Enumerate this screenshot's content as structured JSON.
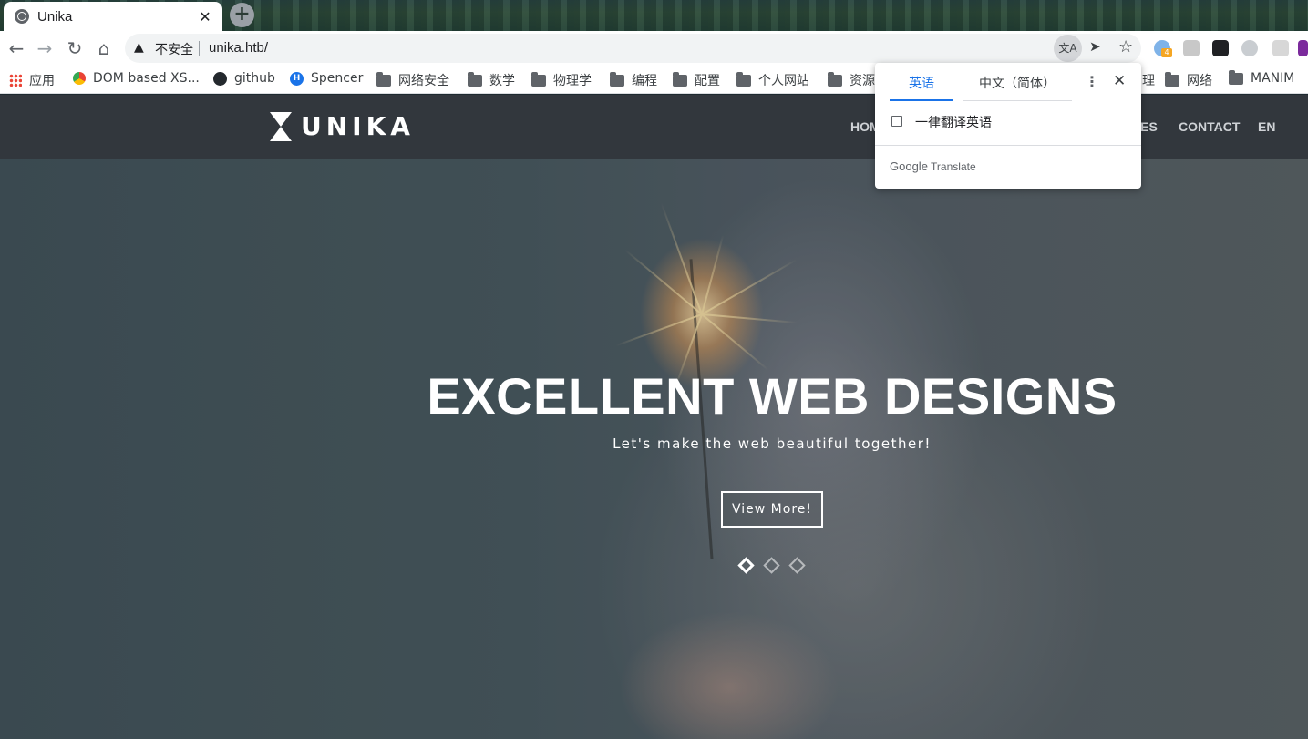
{
  "browser": {
    "tab": {
      "title": "Unika",
      "close": "✕"
    },
    "new_tab": "+",
    "omnibox": {
      "security_label": "不安全",
      "url": "unika.htb/"
    },
    "extensions": {
      "badge_count": "4"
    }
  },
  "bookmarks": [
    {
      "label": "应用",
      "icon": "apps-icon"
    },
    {
      "label": "DOM based XS...",
      "icon": "site-icon"
    },
    {
      "label": "github",
      "icon": "github-icon"
    },
    {
      "label": "Spencer",
      "icon": "hexo-icon"
    },
    {
      "label": "网络安全",
      "icon": "folder-icon"
    },
    {
      "label": "数学",
      "icon": "folder-icon"
    },
    {
      "label": "物理学",
      "icon": "folder-icon"
    },
    {
      "label": "编程",
      "icon": "folder-icon"
    },
    {
      "label": "配置",
      "icon": "folder-icon"
    },
    {
      "label": "个人网站",
      "icon": "folder-icon"
    },
    {
      "label": "资源",
      "icon": "folder-icon"
    },
    {
      "label": "理",
      "icon": "folder-icon"
    },
    {
      "label": "网络",
      "icon": "folder-icon"
    },
    {
      "label": "MANIM",
      "icon": "folder-icon"
    }
  ],
  "site": {
    "logo_text": "UNIKA",
    "menu": [
      "HOM",
      "CES",
      "CONTACT",
      "EN"
    ],
    "hero": {
      "headline": "EXCELLENT WEB DESIGNS",
      "tagline": "Let's make the web beautiful together!",
      "cta": "View More!",
      "slides": 3,
      "active_slide": 1
    }
  },
  "translate_popup": {
    "source_language": "英语",
    "target_language": "中文（简体）",
    "always_translate": "一律翻译英语",
    "always_translate_checked": false,
    "footer_brand": "Google",
    "footer_product": "Translate"
  }
}
